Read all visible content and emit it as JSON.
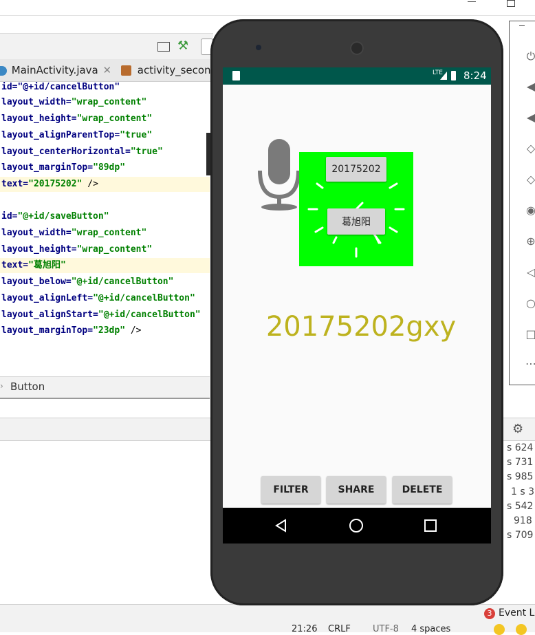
{
  "ide": {
    "tabs": [
      {
        "label": "MainActivity.java"
      },
      {
        "label": "activity_second"
      }
    ],
    "code": {
      "line1": "id=\"@+id/cancelButton\"",
      "line2_attr": "layout_width=",
      "line2_val": "\"wrap_content\"",
      "line3_attr": "layout_height=",
      "line3_val": "\"wrap_content\"",
      "line4_attr": "layout_alignParentTop=",
      "line4_val": "\"true\"",
      "line5_attr": "layout_centerHorizontal=",
      "line5_val": "\"true\"",
      "line6_attr": "layout_marginTop=",
      "line6_val": "\"89dp\"",
      "line7_attr": "text=",
      "line7_val": "\"20175202\"",
      "line7_end": " />",
      "line8_attr": "id=",
      "line8_val": "\"@+id/saveButton\"",
      "line9_attr": "layout_width=",
      "line9_val": "\"wrap_content\"",
      "line10_attr": "layout_height=",
      "line10_val": "\"wrap_content\"",
      "line11_attr": "text=",
      "line11_val": "\"葛旭阳\"",
      "line12_attr": "layout_below=",
      "line12_val": "\"@+id/cancelButton\"",
      "line13_attr": "layout_alignLeft=",
      "line13_val": "\"@+id/cancelButton\"",
      "line14_attr": "layout_alignStart=",
      "line14_val": "\"@+id/cancelButton\"",
      "line15_attr": "layout_marginTop=",
      "line15_val": "\"23dp\"",
      "line15_end": " />"
    },
    "breadcrumb": "Button",
    "log_lines": [
      "s 624",
      "s 731",
      "s 985",
      "1 s 3",
      "s 542",
      "918",
      "s 709"
    ],
    "event_log_count": "3",
    "event_log_label": "Event Lo",
    "status_bar": {
      "position": "21:26",
      "line_sep": "CRLF",
      "encoding": "UTF-8",
      "indent": "4 spaces"
    }
  },
  "phone": {
    "status": {
      "network": "LTE",
      "time": "8:24"
    },
    "app": {
      "button_top": "20175202",
      "button_name": "葛旭阳",
      "big_text": "20175202gxy",
      "big_text_color": "#bdb21e",
      "green_box_color": "#00ff00",
      "filter_label": "FILTER",
      "share_label": "SHARE",
      "delete_label": "DELETE"
    }
  }
}
